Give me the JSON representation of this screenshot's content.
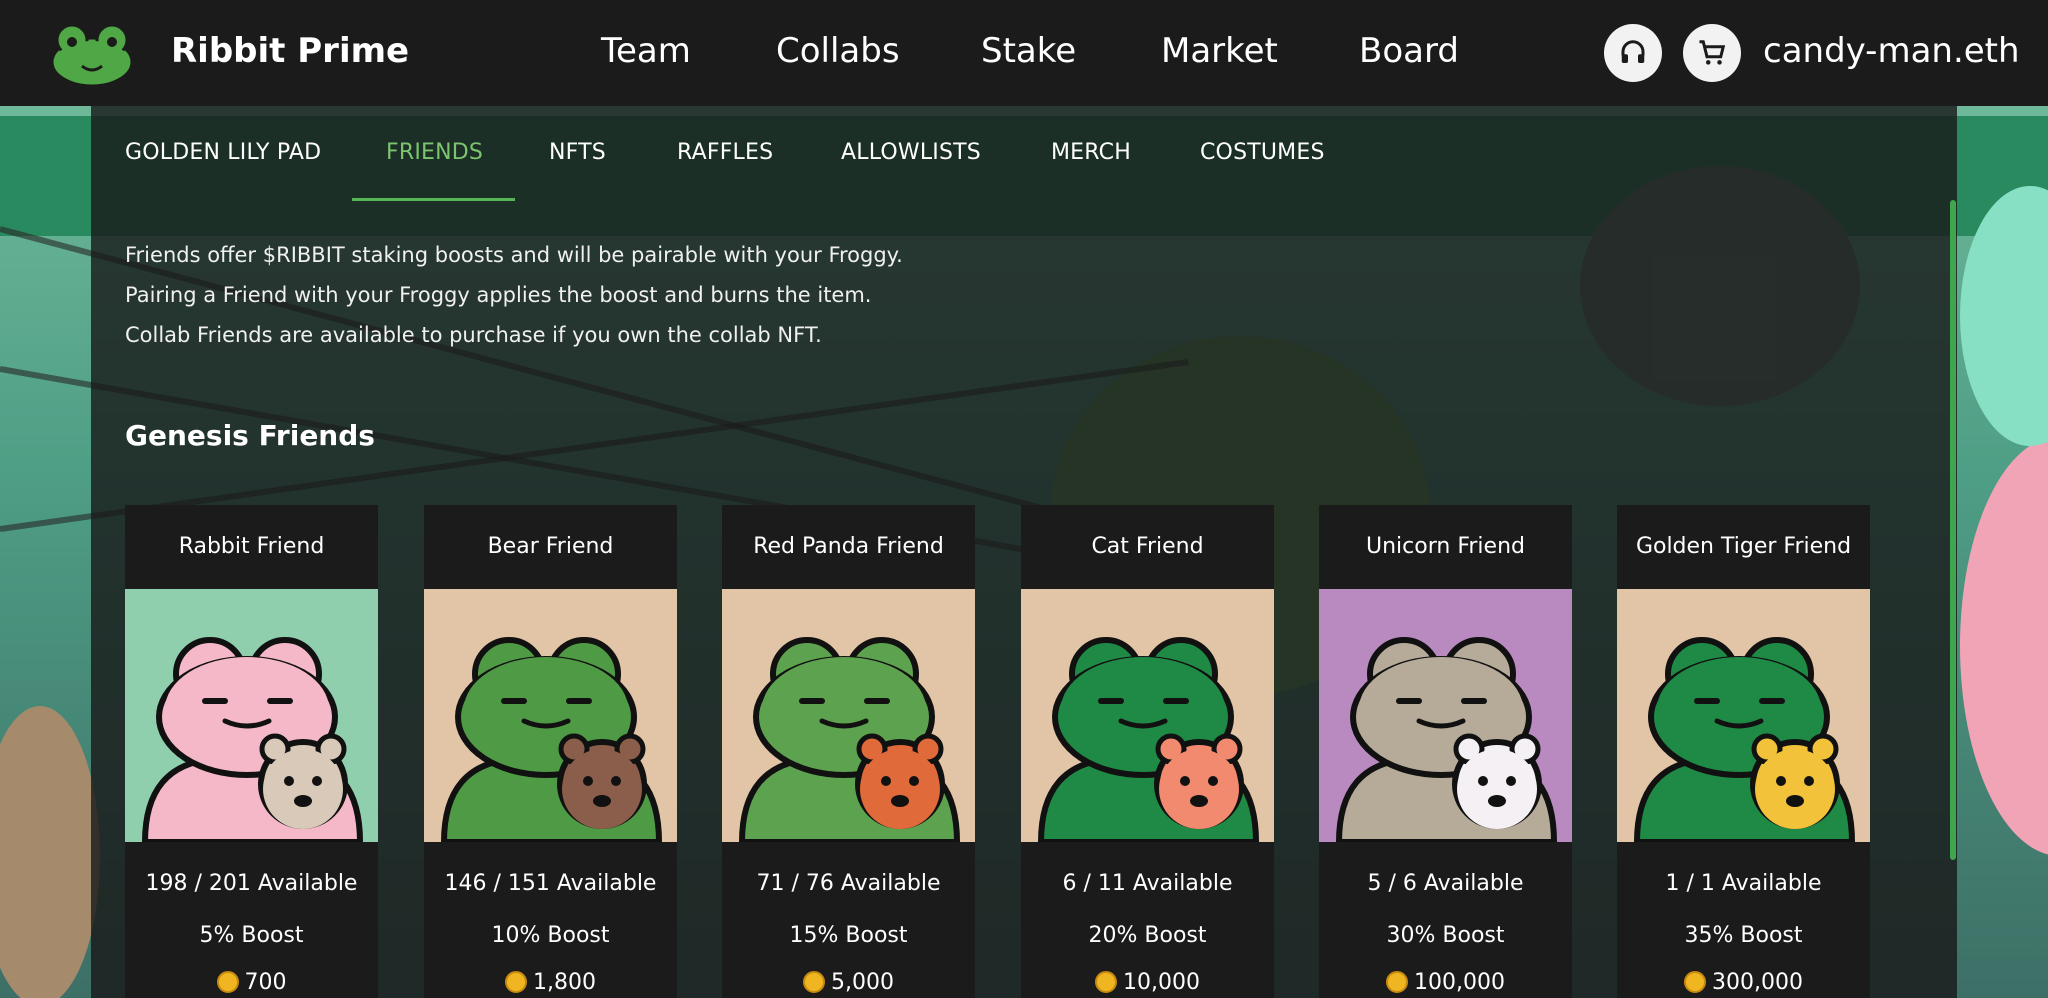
{
  "brand": {
    "name": "Ribbit Prime"
  },
  "nav": {
    "items": [
      {
        "label": "Team"
      },
      {
        "label": "Collabs"
      },
      {
        "label": "Stake"
      },
      {
        "label": "Market"
      },
      {
        "label": "Board"
      }
    ],
    "support_icon": "headphones-icon",
    "cart_icon": "cart-icon",
    "user": "candy-man.eth"
  },
  "tabs": [
    {
      "label": "GOLDEN LILY PAD"
    },
    {
      "label": "FRIENDS",
      "active": true
    },
    {
      "label": "NFTS"
    },
    {
      "label": "RAFFLES"
    },
    {
      "label": "ALLOWLISTS"
    },
    {
      "label": "MERCH"
    },
    {
      "label": "COSTUMES"
    }
  ],
  "description": [
    "Friends offer $RIBBIT staking boosts and will be pairable with your Froggy.",
    "Pairing a Friend with your Froggy applies the boost and burns the item.",
    "Collab Friends are available to purchase if you own the collab NFT."
  ],
  "section_title": "Genesis Friends",
  "cards": [
    {
      "title": "Rabbit Friend",
      "available": "198 / 201 Available",
      "boost": "5% Boost",
      "price": "700",
      "bg": "#8fcfad",
      "frog": "#f5b8c8",
      "friend": "#d9c9b8"
    },
    {
      "title": "Bear Friend",
      "available": "146 / 151 Available",
      "boost": "10% Boost",
      "price": "1,800",
      "bg": "#e2c5a6",
      "frog": "#4f9a45",
      "friend": "#8a5e4a"
    },
    {
      "title": "Red Panda Friend",
      "available": "71 / 76 Available",
      "boost": "15% Boost",
      "price": "5,000",
      "bg": "#e2c5a6",
      "frog": "#5da24f",
      "friend": "#e06a3a"
    },
    {
      "title": "Cat Friend",
      "available": "6 / 11 Available",
      "boost": "20% Boost",
      "price": "10,000",
      "bg": "#e2c5a6",
      "frog": "#1f8a45",
      "friend": "#f28a70"
    },
    {
      "title": "Unicorn Friend",
      "available": "5 / 6 Available",
      "boost": "30% Boost",
      "price": "100,000",
      "bg": "#b98ac0",
      "frog": "#b5ab98",
      "friend": "#f4f0f4"
    },
    {
      "title": "Golden Tiger Friend",
      "available": "1 / 1 Available",
      "boost": "35% Boost",
      "price": "300,000",
      "bg": "#e2c5a6",
      "frog": "#1f8a45",
      "friend": "#f2c23a"
    }
  ],
  "colors": {
    "accent": "#7cc46d",
    "coin": "#f0b622"
  }
}
